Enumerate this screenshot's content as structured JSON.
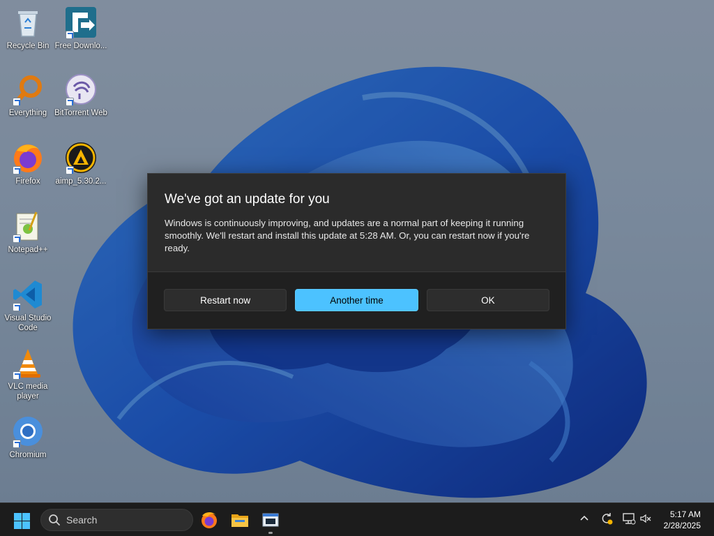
{
  "desktop": {
    "icons": [
      {
        "label": "Recycle Bin",
        "icon": "recycle-bin-icon"
      },
      {
        "label": "Free Downlo...",
        "icon": "free-download-manager-icon"
      },
      {
        "label": "Everything",
        "icon": "everything-search-icon"
      },
      {
        "label": "BitTorrent Web",
        "icon": "bittorrent-icon"
      },
      {
        "label": "Firefox",
        "icon": "firefox-icon"
      },
      {
        "label": "aimp_5.30.2...",
        "icon": "aimp-icon"
      },
      {
        "label": "Notepad++",
        "icon": "notepadpp-icon"
      },
      {
        "label": "Visual Studio Code",
        "icon": "vscode-icon"
      },
      {
        "label": "VLC media player",
        "icon": "vlc-icon"
      },
      {
        "label": "Chromium",
        "icon": "chromium-icon"
      }
    ]
  },
  "dialog": {
    "title": "We've got an update for you",
    "message": "Windows is continuously improving, and updates are a normal part of keeping it running smoothly. We'll restart and install this update at 5:28 AM. Or, you can restart now if you're ready.",
    "buttons": {
      "restart_now": "Restart now",
      "another_time": "Another time",
      "ok": "OK"
    }
  },
  "taskbar": {
    "search_placeholder": "Search",
    "apps": [
      "firefox-icon",
      "file-explorer-icon",
      "active-window-icon"
    ],
    "tray": [
      "chevron-up-icon",
      "update-icon",
      "network-icon",
      "volume-muted-icon"
    ],
    "time": "5:17 AM",
    "date": "2/28/2025"
  },
  "colors": {
    "accent": "#4cc2ff",
    "dialog_bg": "#2b2b2b",
    "taskbar_bg": "#1c1c1c"
  }
}
